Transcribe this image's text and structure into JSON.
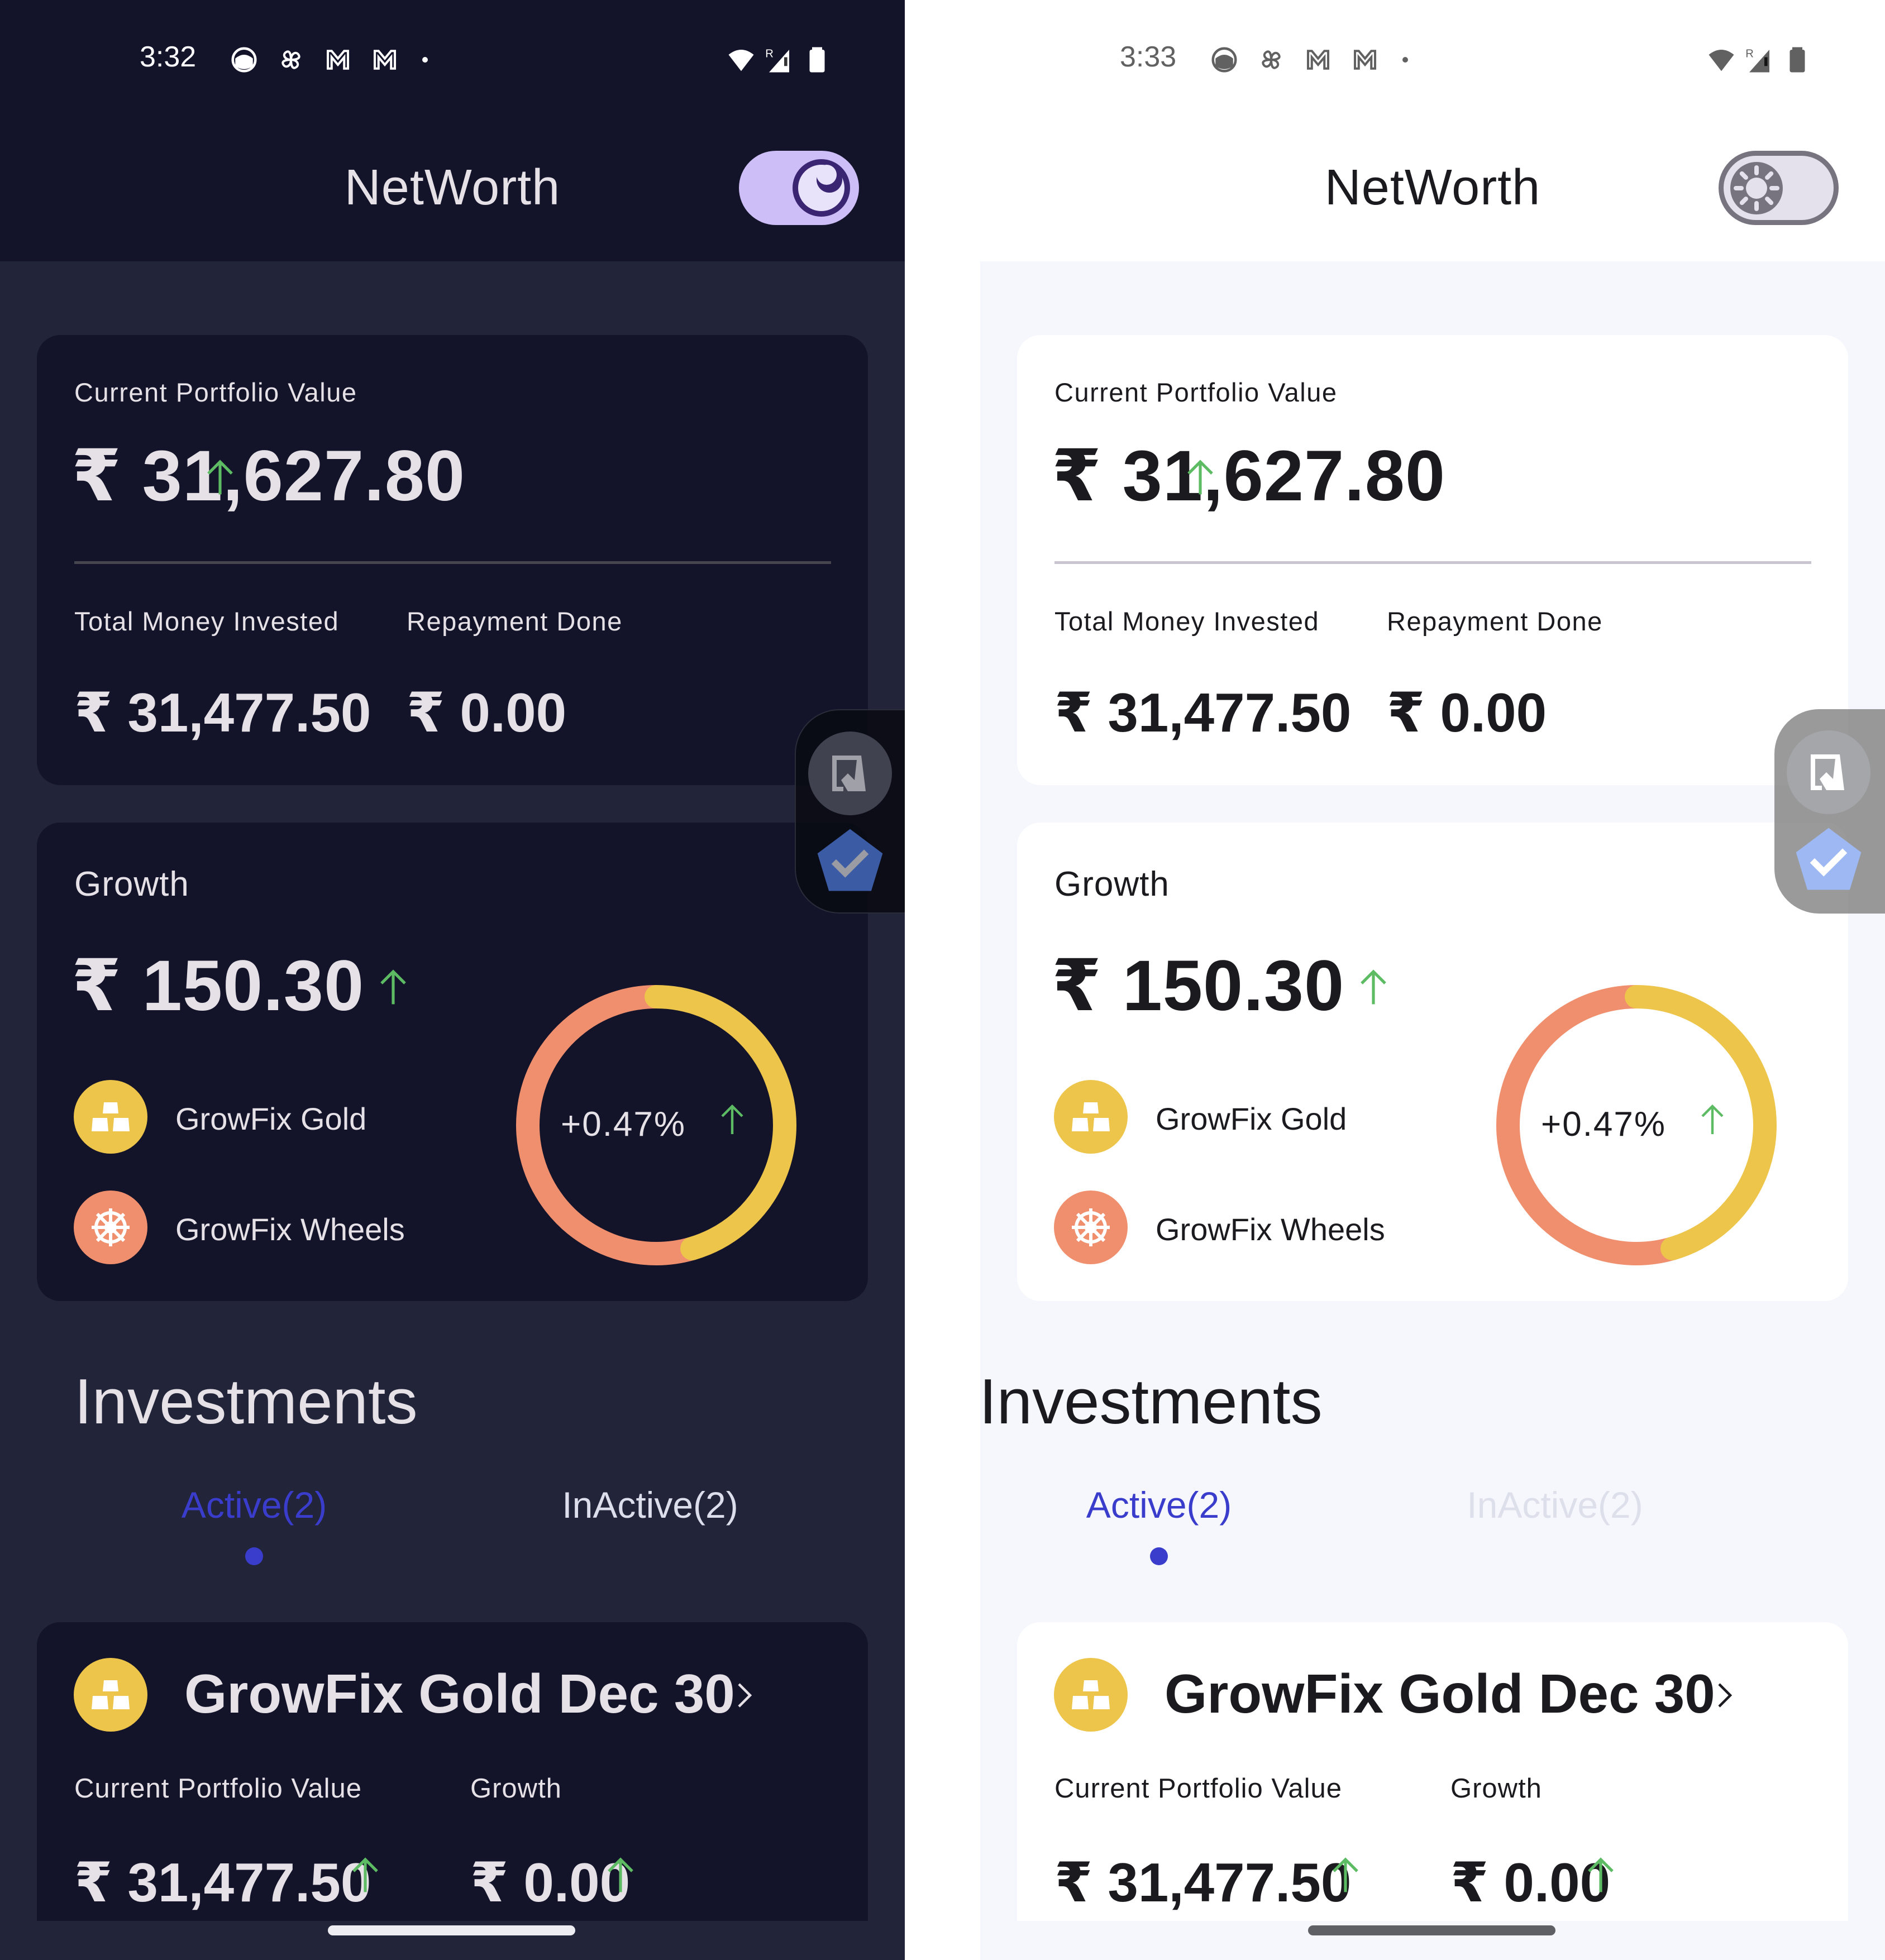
{
  "colors": {
    "dark_header_bg": "#13142A",
    "dark_content_bg": "#22243A",
    "light_content_bg": "#F6F7FC",
    "accent": "#3A3DCB",
    "up_arrow": "#5DBB63",
    "gold": "#EDC54A",
    "wheels": "#F08F6E",
    "toggle_dark": "#CDBEF7",
    "toggle_light": "#777480"
  },
  "screens": [
    {
      "theme": "dark",
      "status_bar": {
        "time": "3:32",
        "notification_icons": [
          "face-icon",
          "pinwheel-icon",
          "gmail-icon",
          "gmail-icon",
          "dot-icon"
        ],
        "system_icons": [
          "wifi-icon",
          "signal-roaming-icon",
          "battery-icon"
        ],
        "roaming_label": "R"
      },
      "header": {
        "title": "NetWorth",
        "theme_toggle_icon": "moon-icon",
        "theme_toggle_state": "dark"
      },
      "portfolio_card": {
        "label": "Current Portfolio Value",
        "value": "₹ 31,627.80",
        "trend": "up",
        "invested_label": "Total Money Invested",
        "invested_value": "₹ 31,477.50",
        "repayment_label": "Repayment Done",
        "repayment_value": "₹ 0.00"
      },
      "growth_card": {
        "label": "Growth",
        "value": "₹ 150.30",
        "trend": "up",
        "legend": [
          {
            "label": "GrowFix Gold",
            "icon": "gold-bars-icon"
          },
          {
            "label": "GrowFix Wheels",
            "icon": "wheel-icon"
          }
        ],
        "donut_center_text": "+0.47%"
      },
      "investments": {
        "title": "Investments",
        "tabs": [
          {
            "label": "Active(2)",
            "selected": true
          },
          {
            "label": "InActive(2)",
            "selected": false
          }
        ],
        "items": [
          {
            "title": "GrowFix Gold Dec 30",
            "icon": "gold-bars-icon",
            "portfolio_label": "Current Portfolio Value",
            "portfolio_value": "₹ 31,477.50",
            "growth_label": "Growth",
            "growth_value": "₹ 0.00"
          }
        ]
      },
      "floating_widget": [
        "screenshot-icon",
        "verified-check-icon"
      ]
    },
    {
      "theme": "light",
      "status_bar": {
        "time": "3:33",
        "notification_icons": [
          "face-icon",
          "pinwheel-icon",
          "gmail-icon",
          "gmail-icon",
          "dot-icon"
        ],
        "system_icons": [
          "wifi-icon",
          "signal-roaming-icon",
          "battery-icon"
        ],
        "roaming_label": "R"
      },
      "header": {
        "title": "NetWorth",
        "theme_toggle_icon": "sun-icon",
        "theme_toggle_state": "light"
      },
      "portfolio_card": {
        "label": "Current Portfolio Value",
        "value": "₹ 31,627.80",
        "trend": "up",
        "invested_label": "Total Money Invested",
        "invested_value": "₹ 31,477.50",
        "repayment_label": "Repayment Done",
        "repayment_value": "₹ 0.00"
      },
      "growth_card": {
        "label": "Growth",
        "value": "₹ 150.30",
        "trend": "up",
        "legend": [
          {
            "label": "GrowFix Gold",
            "icon": "gold-bars-icon"
          },
          {
            "label": "GrowFix Wheels",
            "icon": "wheel-icon"
          }
        ],
        "donut_center_text": "+0.47%"
      },
      "investments": {
        "title": "Investments",
        "tabs": [
          {
            "label": "Active(2)",
            "selected": true
          },
          {
            "label": "InActive(2)",
            "selected": false
          }
        ],
        "items": [
          {
            "title": "GrowFix Gold Dec 30",
            "icon": "gold-bars-icon",
            "portfolio_label": "Current Portfolio Value",
            "portfolio_value": "₹ 31,477.50",
            "growth_label": "Growth",
            "growth_value": "₹ 0.00"
          }
        ]
      },
      "floating_widget": [
        "screenshot-icon",
        "verified-check-icon"
      ]
    }
  ],
  "chart_data": {
    "type": "pie",
    "title": "",
    "center_label": "+0.47%",
    "categories": [
      "GrowFix Gold",
      "GrowFix Wheels"
    ],
    "values": [
      45.5,
      54.5
    ],
    "unit": "percent of ring (estimated)",
    "colors": [
      "#EDC54A",
      "#F08F6E"
    ],
    "start": "top, clockwise",
    "legend": "left"
  }
}
